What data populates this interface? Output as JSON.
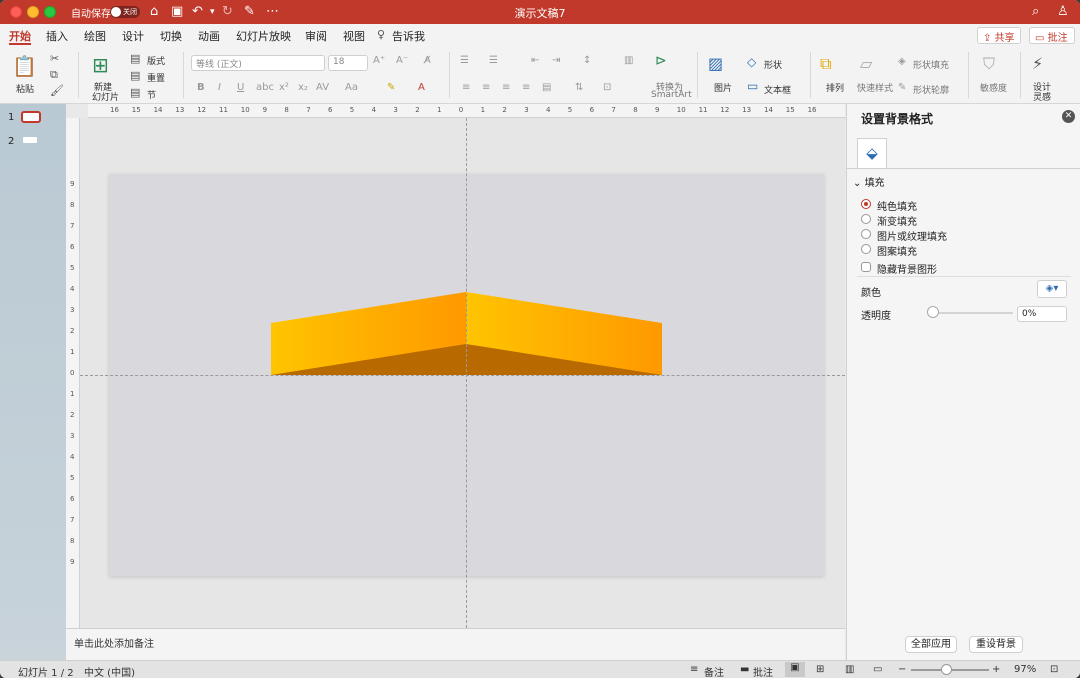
{
  "titlebar": {
    "autosave_label": "自动保存",
    "autosave_state": "关闭",
    "document_title": "演示文稿7"
  },
  "tabs": [
    "开始",
    "插入",
    "绘图",
    "设计",
    "切换",
    "动画",
    "幻灯片放映",
    "审阅",
    "视图",
    "告诉我"
  ],
  "header_buttons": {
    "share": "共享",
    "comment": "批注"
  },
  "ribbon": {
    "paste": "粘贴",
    "new_slide": [
      "新建",
      "幻灯片"
    ],
    "layout": "版式",
    "reset": "重置",
    "section": "节",
    "font_name": "等线 (正文)",
    "font_size": "18",
    "bold": "B",
    "italic": "I",
    "underline": "U",
    "convert_smartart": [
      "转换为",
      "SmartArt"
    ],
    "picture": "图片",
    "shape": "形状",
    "textbox": "文本框",
    "arrange": "排列",
    "quick_styles": "快速样式",
    "shape_fill": "形状填充",
    "shape_outline": "形状轮廓",
    "sensitivity": "敏感度",
    "designer": [
      "设计",
      "灵感"
    ]
  },
  "slides": [
    "1",
    "2"
  ],
  "notes_placeholder": "单击此处添加备注",
  "shape": {
    "colors": {
      "front_light": "#ffc400",
      "front_dark": "#ff9900",
      "shadow": "#b86a00",
      "slide_bg": "#d9d8dc"
    }
  },
  "pane": {
    "title": "设置背景格式",
    "section": "填充",
    "options": [
      "纯色填充",
      "渐变填充",
      "图片或纹理填充",
      "图案填充"
    ],
    "selected_option": "纯色填充",
    "hide_bg": "隐藏背景图形",
    "color_label": "颜色",
    "transparency_label": "透明度",
    "transparency_value": "0%",
    "apply_all": "全部应用",
    "reset_bg": "重设背景"
  },
  "status": {
    "slide_info": "幻灯片 1 / 2",
    "language": "中文 (中国)",
    "notes": "备注",
    "comments": "批注",
    "zoom": "97%"
  },
  "rulers": {
    "top": [
      "16",
      "15",
      "14",
      "13",
      "12",
      "11",
      "10",
      "9",
      "8",
      "7",
      "6",
      "5",
      "4",
      "3",
      "2",
      "1",
      "0",
      "1",
      "2",
      "3",
      "4",
      "5",
      "6",
      "7",
      "8",
      "9",
      "10",
      "11",
      "12",
      "13",
      "14",
      "15",
      "16"
    ],
    "left": [
      "9",
      "8",
      "7",
      "6",
      "5",
      "4",
      "3",
      "2",
      "1",
      "0",
      "1",
      "2",
      "3",
      "4",
      "5",
      "6",
      "7",
      "8",
      "9"
    ]
  }
}
